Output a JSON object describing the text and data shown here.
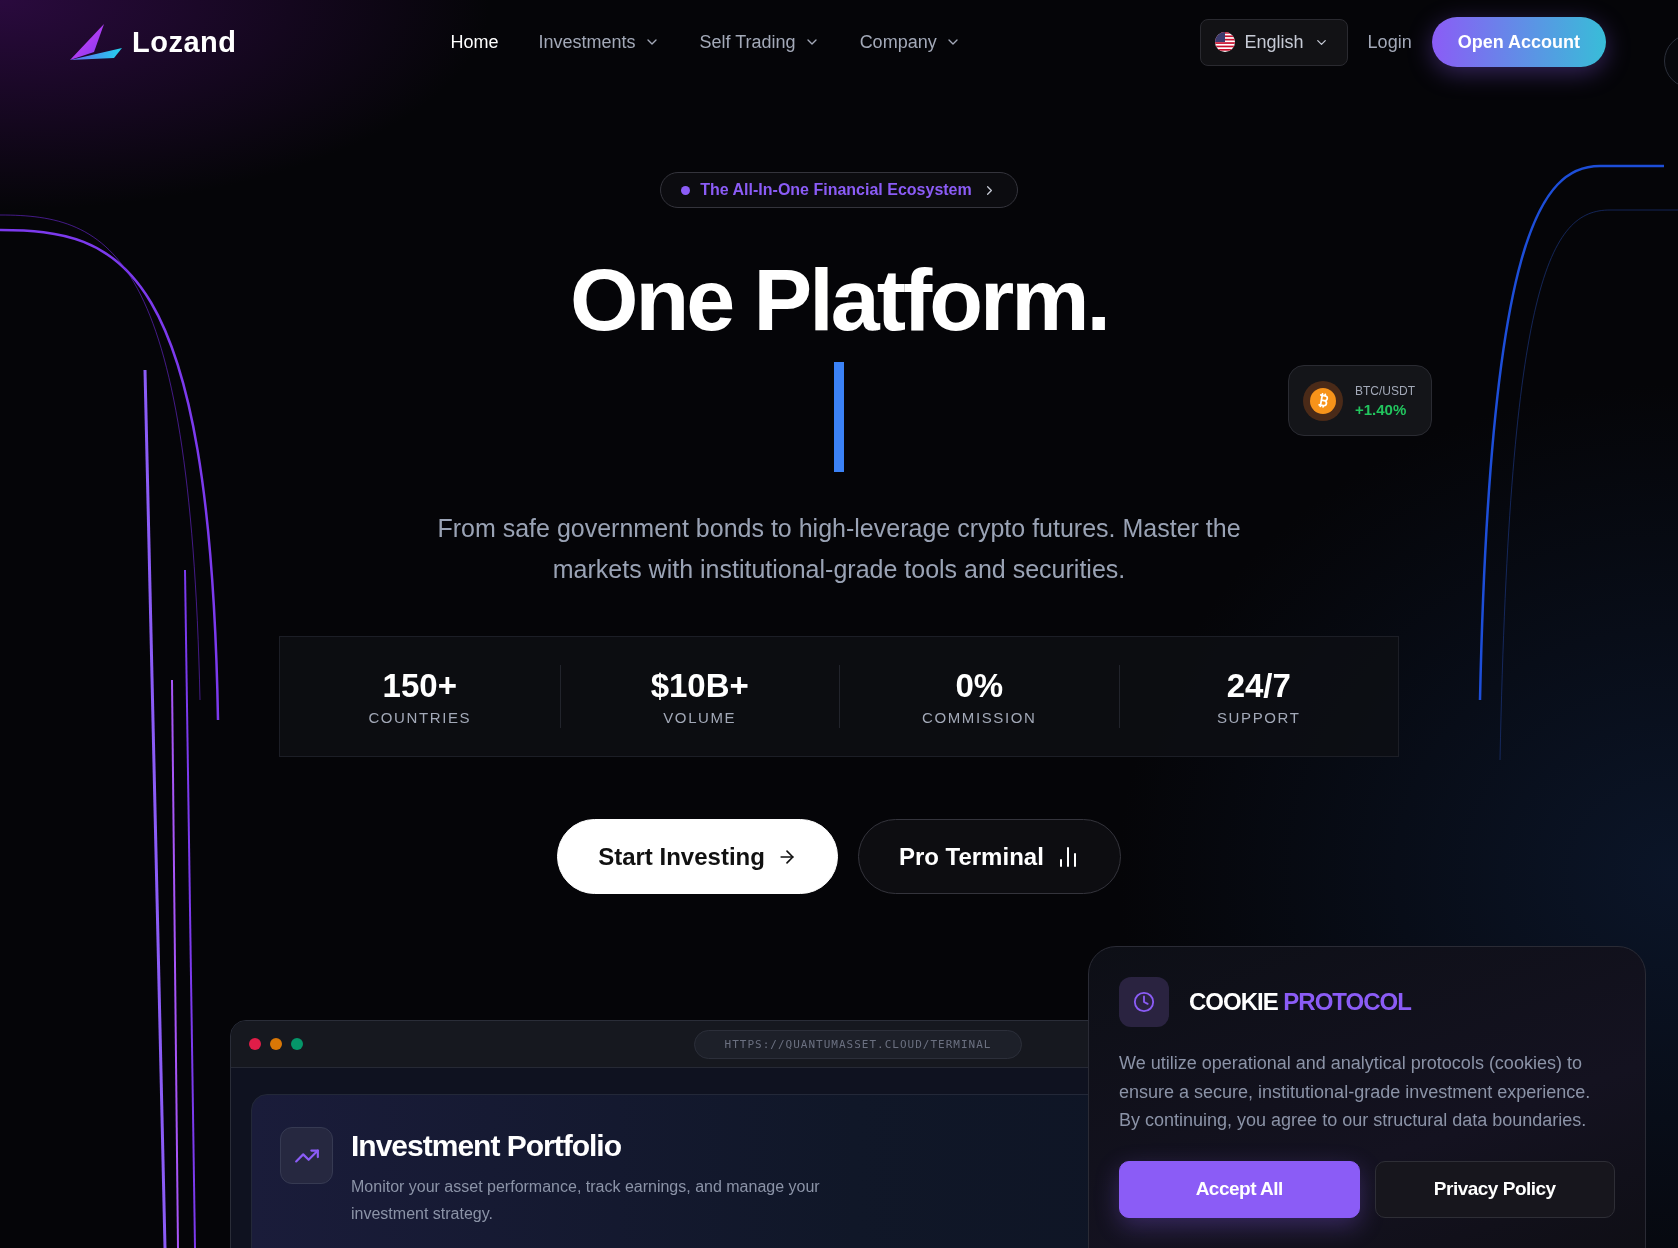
{
  "header": {
    "logo": "Lozand",
    "nav": [
      {
        "label": "Home",
        "selected": true,
        "dropdown": false
      },
      {
        "label": "Investments",
        "selected": false,
        "dropdown": true
      },
      {
        "label": "Self Trading",
        "selected": false,
        "dropdown": true
      },
      {
        "label": "Company",
        "selected": false,
        "dropdown": true
      }
    ],
    "language": "English",
    "login": "Login",
    "cta": "Open Account"
  },
  "hero": {
    "badge": "The All-In-One Financial Ecosystem",
    "title": "One Platform.",
    "subtitle": "From safe government bonds to high-leverage crypto futures. Master the markets with institutional-grade tools and securities.",
    "stats": [
      {
        "value": "150+",
        "label": "COUNTRIES"
      },
      {
        "value": "$10B+",
        "label": "VOLUME"
      },
      {
        "value": "0%",
        "label": "COMMISSION"
      },
      {
        "value": "24/7",
        "label": "SUPPORT"
      }
    ],
    "buttons": [
      {
        "label": "Start Investing",
        "kind": "primary"
      },
      {
        "label": "Pro Terminal",
        "kind": "secondary"
      }
    ]
  },
  "ticker": {
    "pair": "BTC/USDT",
    "change": "+1.40%"
  },
  "terminal": {
    "url": "HTTPS://QUANTUMASSET.CLOUD/TERMINAL",
    "title": "Investment Portfolio",
    "description": "Monitor your asset performance, track earnings, and manage your investment strategy."
  },
  "cookie": {
    "title": "COOKIE",
    "title_accent": "PROTOCOL",
    "body": "We utilize operational and analytical protocols (cookies) to ensure a secure, institutional-grade investment experience. By continuing, you agree to our structural data boundaries.",
    "buttons": [
      {
        "label": "Accept All",
        "kind": "primary"
      },
      {
        "label": "Privacy Policy",
        "kind": "secondary"
      }
    ]
  }
}
